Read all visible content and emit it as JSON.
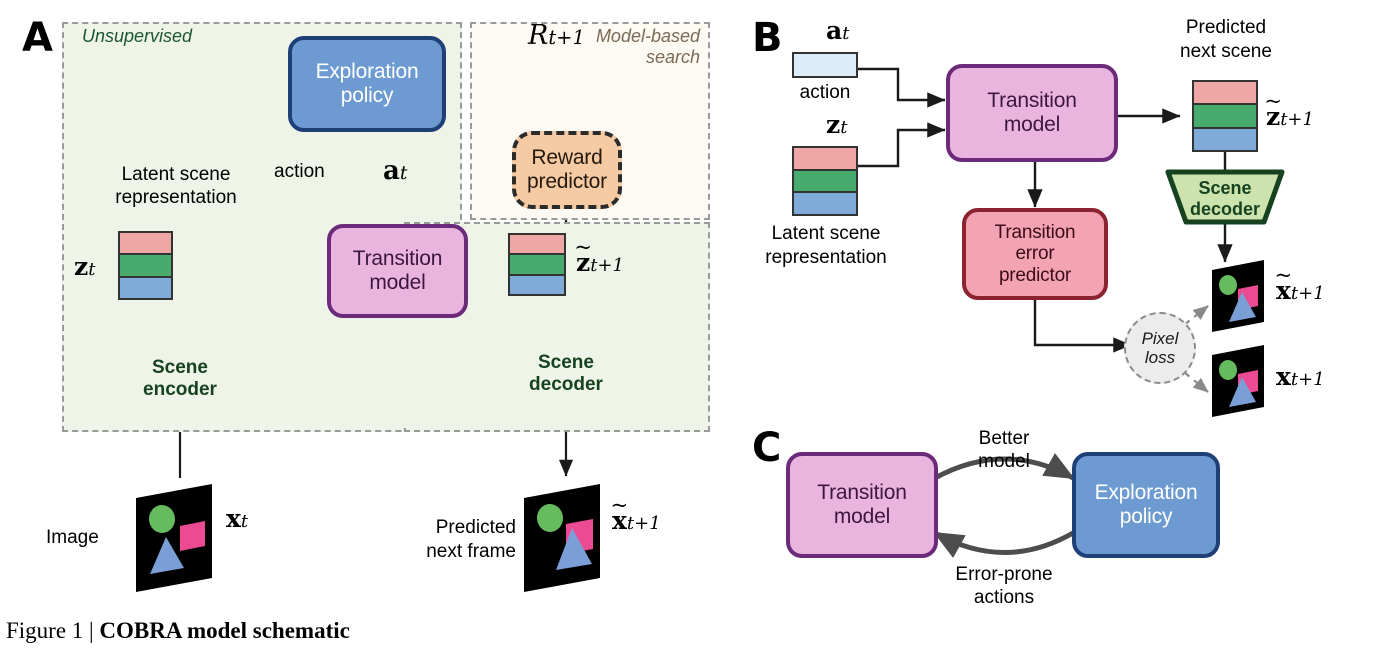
{
  "figure": {
    "caption_prefix": "Figure 1 |",
    "caption_title": "COBRA model schematic"
  },
  "colors": {
    "explore_fill": "#6d9bd1",
    "explore_border": "#1f3f77",
    "transition_fill": "#e9b5de",
    "transition_border": "#6b2a7a",
    "reward_fill": "#f6caa2",
    "reward_border": "#2b2b2b",
    "error_fill": "#f4a3b4",
    "error_border": "#8c2330",
    "encoder_fill": "#cde3ae",
    "encoder_border": "#16421f",
    "latent_red": "#efa7a6",
    "latent_green": "#48ab6e",
    "latent_blue": "#7fabd9",
    "action_fill": "#dcedf9",
    "unsupervised_bg": "#eef5e8",
    "modelsearch_bg": "#fcfaf2",
    "region_border": "#9a9a9a",
    "pixel_loss_fill": "#ececec"
  },
  "panelA": {
    "letter": "A",
    "region_unsupervised_label": "Unsupervised",
    "region_modelbased_label_line1": "Model-based",
    "region_modelbased_label_line2": "search",
    "exploration_policy": "Exploration\npolicy",
    "exploration_policy_line1": "Exploration",
    "exploration_policy_line2": "policy",
    "transition_model_line1": "Transition",
    "transition_model_line2": "model",
    "reward_predictor_line1": "Reward",
    "reward_predictor_line2": "predictor",
    "reward_output": "R",
    "reward_output_sub": "t+1",
    "action_label": "action",
    "action_symbol": "a",
    "action_symbol_sub": "t",
    "latent_label_line1": "Latent scene",
    "latent_label_line2": "representation",
    "latent_symbol": "z",
    "latent_symbol_sub": "t",
    "next_latent_symbol": "z",
    "next_latent_sub": "t+1",
    "scene_encoder_line1": "Scene",
    "scene_encoder_line2": "encoder",
    "scene_decoder_line1": "Scene",
    "scene_decoder_line2": "decoder",
    "image_label": "Image",
    "image_symbol": "x",
    "image_symbol_sub": "t",
    "predicted_frame_line1": "Predicted",
    "predicted_frame_line2": "next frame",
    "predicted_frame_symbol": "x",
    "predicted_frame_sub": "t+1"
  },
  "panelB": {
    "letter": "B",
    "action_symbol": "a",
    "action_symbol_sub": "t",
    "action_label": "action",
    "latent_symbol": "z",
    "latent_symbol_sub": "t",
    "latent_label_line1": "Latent scene",
    "latent_label_line2": "representation",
    "transition_model_line1": "Transition",
    "transition_model_line2": "model",
    "error_predictor_line1": "Transition",
    "error_predictor_line2": "error",
    "error_predictor_line3": "predictor",
    "predicted_scene_line1": "Predicted",
    "predicted_scene_line2": "next scene",
    "next_latent_symbol": "z",
    "next_latent_sub": "t+1",
    "scene_decoder_line1": "Scene",
    "scene_decoder_line2": "decoder",
    "pixel_loss_line1": "Pixel",
    "pixel_loss_line2": "loss",
    "predicted_frame_symbol": "x",
    "predicted_frame_sub": "t+1",
    "true_frame_symbol": "x",
    "true_frame_sub": "t+1"
  },
  "panelC": {
    "letter": "C",
    "transition_model_line1": "Transition",
    "transition_model_line2": "model",
    "exploration_policy_line1": "Exploration",
    "exploration_policy_line2": "policy",
    "forward_label_line1": "Better",
    "forward_label_line2": "model",
    "back_label_line1": "Error-prone",
    "back_label_line2": "actions"
  }
}
